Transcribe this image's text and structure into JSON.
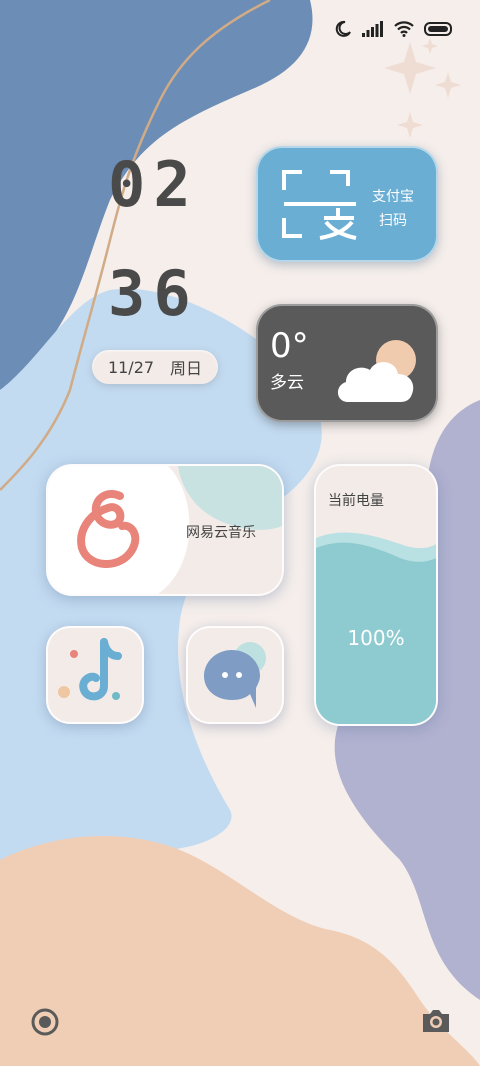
{
  "clock": {
    "hour": "02",
    "minute": "36"
  },
  "date": {
    "day": "11/27",
    "weekday": "周日"
  },
  "alipay": {
    "line1": "支付宝",
    "line2": "扫码"
  },
  "weather": {
    "temp": "0°",
    "condition": "多云"
  },
  "music": {
    "label": "网易云音乐"
  },
  "battery": {
    "label": "当前电量",
    "percent": "100%",
    "level": 1.0
  },
  "colors": {
    "alipay": "#6aaed3",
    "weather_card": "#5a5a5a",
    "battery_fill": "#8ecbd1",
    "music_icon": "#e8847a"
  },
  "icons": {
    "status": [
      "moon-icon",
      "signal-icon",
      "wifi-icon",
      "battery-icon"
    ],
    "bottom_left": "record-icon",
    "bottom_right": "camera-icon"
  }
}
